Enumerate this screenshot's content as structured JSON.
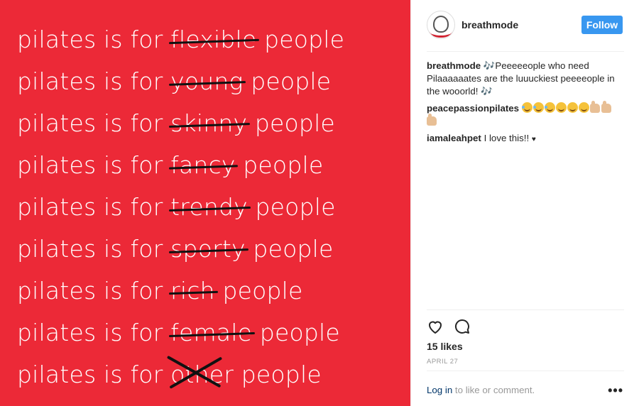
{
  "image": {
    "text_color": "#ffffff",
    "background": "#ec2937",
    "lines": [
      {
        "prefix": "pilates is for ",
        "struck": "flexible",
        "suffix": " people",
        "mark": "strike"
      },
      {
        "prefix": "pilates is for ",
        "struck": "young",
        "suffix": " people",
        "mark": "strike"
      },
      {
        "prefix": "pilates is for ",
        "struck": "skinny",
        "suffix": " people",
        "mark": "strike"
      },
      {
        "prefix": "pilates is for ",
        "struck": "fancy",
        "suffix": " people",
        "mark": "strike"
      },
      {
        "prefix": "pilates is for ",
        "struck": "trendy",
        "suffix": " people",
        "mark": "strike"
      },
      {
        "prefix": "pilates is for ",
        "struck": "sporty",
        "suffix": " people",
        "mark": "strike"
      },
      {
        "prefix": "pilates is for ",
        "struck": "rich",
        "suffix": " people",
        "mark": "strike"
      },
      {
        "prefix": "pilates is for ",
        "struck": "female",
        "suffix": " people",
        "mark": "strike"
      },
      {
        "prefix": "pilates is for ",
        "struck": "other",
        "suffix": " people",
        "mark": "cross"
      }
    ]
  },
  "header": {
    "username": "breathmode",
    "follow_label": "Follow",
    "accent": "#3897f0"
  },
  "comments": [
    {
      "user": "breathmode",
      "text_parts": [
        "🎶",
        "Peeeeeople who need Pilaaaaaates are the luuuckiest peeeeople in the wooorld! ",
        "🎶"
      ]
    },
    {
      "user": "peacepassionpilates",
      "emoji_note": "laughing, smiling and thumbs-up emoji"
    },
    {
      "user": "iamaleahpet",
      "text": "I love this!!",
      "heart": "♥"
    }
  ],
  "actions": {
    "like_icon": "heart-outline-icon",
    "comment_icon": "comment-bubble-icon"
  },
  "likes": "15 likes",
  "date": "APRIL 27",
  "footer": {
    "login_link": "Log in",
    "login_text": " to like or comment.",
    "more_icon": "•••"
  }
}
